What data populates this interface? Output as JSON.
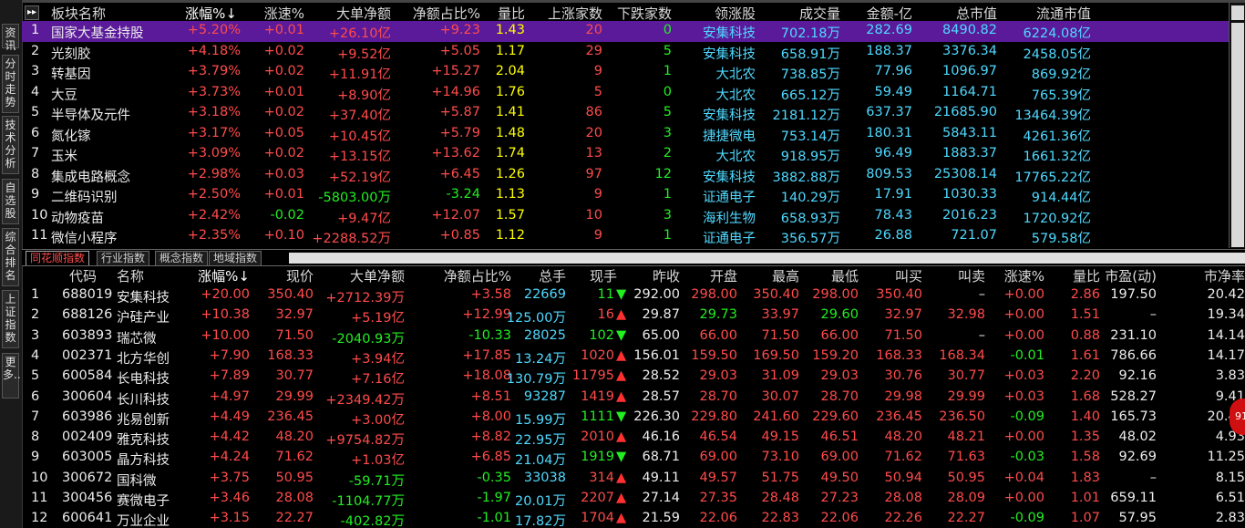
{
  "left_tabs": [
    "资讯",
    "分时走势",
    "技术分析",
    "自选股",
    "综合排名",
    "上证指数",
    "更多.."
  ],
  "upper": {
    "headers": [
      "板块名称",
      "涨幅%↓",
      "涨速%",
      "大单净额",
      "净额占比%",
      "量比",
      "上涨家数",
      "下跌家数",
      "领涨股",
      "成交量",
      "金额-亿",
      "总市值",
      "流通市值"
    ],
    "rows": [
      [
        "1",
        "国家大基金持股",
        "+5.20%",
        "+0.01",
        "+26.10亿",
        "+9.23",
        "1.43",
        "20",
        "0",
        "安集科技",
        "702.18万",
        "282.69",
        "8490.82",
        "6224.08亿"
      ],
      [
        "2",
        "光刻胶",
        "+4.18%",
        "+0.02",
        "+9.52亿",
        "+5.05",
        "1.17",
        "29",
        "5",
        "安集科技",
        "658.91万",
        "188.37",
        "3376.34",
        "2458.05亿"
      ],
      [
        "3",
        "转基因",
        "+3.79%",
        "+0.02",
        "+11.91亿",
        "+15.27",
        "2.04",
        "9",
        "1",
        "大北农",
        "738.85万",
        "77.96",
        "1096.97",
        "869.92亿"
      ],
      [
        "4",
        "大豆",
        "+3.73%",
        "+0.01",
        "+8.90亿",
        "+14.96",
        "1.76",
        "5",
        "0",
        "大北农",
        "665.12万",
        "59.49",
        "1164.71",
        "765.39亿"
      ],
      [
        "5",
        "半导体及元件",
        "+3.18%",
        "+0.02",
        "+37.40亿",
        "+5.87",
        "1.41",
        "86",
        "5",
        "安集科技",
        "2181.12万",
        "637.37",
        "21685.90",
        "13464.39亿"
      ],
      [
        "6",
        "氮化镓",
        "+3.17%",
        "+0.05",
        "+10.45亿",
        "+5.79",
        "1.48",
        "20",
        "3",
        "捷捷微电",
        "753.14万",
        "180.31",
        "5843.11",
        "4261.36亿"
      ],
      [
        "7",
        "玉米",
        "+3.09%",
        "+0.02",
        "+13.15亿",
        "+13.62",
        "1.74",
        "13",
        "2",
        "大北农",
        "918.95万",
        "96.49",
        "1883.37",
        "1661.32亿"
      ],
      [
        "8",
        "集成电路概念",
        "+2.98%",
        "+0.03",
        "+52.19亿",
        "+6.45",
        "1.26",
        "97",
        "12",
        "安集科技",
        "3882.88万",
        "809.53",
        "25308.14",
        "17765.22亿"
      ],
      [
        "9",
        "二维码识别",
        "+2.50%",
        "+0.01",
        "-5803.00万",
        "-3.24",
        "1.13",
        "9",
        "1",
        "证通电子",
        "140.29万",
        "17.91",
        "1030.33",
        "914.44亿"
      ],
      [
        "10",
        "动物疫苗",
        "+2.42%",
        "-0.02",
        "+9.47亿",
        "+12.07",
        "1.57",
        "10",
        "3",
        "海利生物",
        "658.93万",
        "78.43",
        "2016.23",
        "1720.92亿"
      ],
      [
        "11",
        "微信小程序",
        "+2.35%",
        "+0.10",
        "+2288.52万",
        "+0.85",
        "1.12",
        "9",
        "1",
        "证通电子",
        "356.57万",
        "26.88",
        "721.07",
        "579.58亿"
      ]
    ]
  },
  "tabs": [
    "同花顺指数",
    "行业指数",
    "概念指数",
    "地域指数"
  ],
  "lower": {
    "headers": [
      "代码",
      "名称",
      "涨幅%↓",
      "现价",
      "大单净额",
      "净额占比%",
      "总手",
      "现手",
      "昨收",
      "开盘",
      "最高",
      "最低",
      "叫买",
      "叫卖",
      "涨速%",
      "量比",
      "市盈(动)",
      "市净率"
    ],
    "rows": [
      [
        "1",
        "688019",
        "安集科技",
        "+20.00",
        "350.40",
        "+2712.39万",
        "+3.58",
        "22669",
        "11",
        "dn",
        "292.00",
        "298.00",
        "350.40",
        "298.00",
        "350.40",
        "–",
        "+0.00",
        "2.86",
        "197.50",
        "20.42"
      ],
      [
        "2",
        "688126",
        "沪硅产业",
        "+10.38",
        "32.97",
        "+5.19亿",
        "+12.99",
        "125.00万",
        "16",
        "up",
        "29.87",
        "29.73",
        "33.97",
        "29.60",
        "32.97",
        "32.98",
        "+0.00",
        "1.51",
        "–",
        "19.34"
      ],
      [
        "3",
        "603893",
        "瑞芯微",
        "+10.00",
        "71.50",
        "-2040.93万",
        "-10.33",
        "28025",
        "102",
        "dn",
        "65.00",
        "66.00",
        "71.50",
        "66.00",
        "71.50",
        "–",
        "+0.00",
        "0.88",
        "231.10",
        "14.14"
      ],
      [
        "4",
        "002371",
        "北方华创",
        "+7.90",
        "168.33",
        "+3.94亿",
        "+17.85",
        "13.24万",
        "1020",
        "up",
        "156.01",
        "159.50",
        "169.50",
        "159.20",
        "168.33",
        "168.34",
        "-0.01",
        "1.61",
        "786.66",
        "14.17"
      ],
      [
        "5",
        "600584",
        "长电科技",
        "+7.89",
        "30.77",
        "+7.16亿",
        "+18.08",
        "130.79万",
        "11795",
        "up",
        "28.52",
        "29.03",
        "31.09",
        "29.03",
        "30.76",
        "30.77",
        "+0.03",
        "2.20",
        "92.16",
        "3.83"
      ],
      [
        "6",
        "300604",
        "长川科技",
        "+4.97",
        "29.99",
        "+2349.42万",
        "+8.51",
        "93287",
        "1419",
        "up",
        "28.57",
        "28.70",
        "30.07",
        "28.70",
        "29.98",
        "29.99",
        "+0.03",
        "1.68",
        "528.27",
        "9.41"
      ],
      [
        "7",
        "603986",
        "兆易创新",
        "+4.49",
        "236.45",
        "+3.00亿",
        "+8.00",
        "15.99万",
        "1111",
        "dn",
        "226.30",
        "229.80",
        "241.60",
        "229.60",
        "236.45",
        "236.50",
        "-0.09",
        "1.40",
        "165.73",
        "20.46"
      ],
      [
        "8",
        "002409",
        "雅克科技",
        "+4.42",
        "48.20",
        "+9754.82万",
        "+8.82",
        "22.95万",
        "2010",
        "up",
        "46.16",
        "46.54",
        "49.15",
        "46.51",
        "48.20",
        "48.21",
        "+0.00",
        "1.35",
        "48.02",
        "4.93"
      ],
      [
        "9",
        "603005",
        "晶方科技",
        "+4.24",
        "71.62",
        "+1.03亿",
        "+6.85",
        "21.04万",
        "1919",
        "dn",
        "68.71",
        "69.00",
        "73.10",
        "69.00",
        "71.62",
        "71.63",
        "-0.03",
        "1.58",
        "92.69",
        "11.25"
      ],
      [
        "10",
        "300672",
        "国科微",
        "+3.75",
        "50.95",
        "-59.71万",
        "-0.35",
        "33038",
        "314",
        "up",
        "49.11",
        "49.57",
        "51.75",
        "49.50",
        "50.94",
        "50.95",
        "+0.04",
        "1.83",
        "–",
        "8.15"
      ],
      [
        "11",
        "300456",
        "赛微电子",
        "+3.46",
        "28.08",
        "-1104.77万",
        "-1.97",
        "20.01万",
        "2207",
        "up",
        "27.14",
        "27.35",
        "28.48",
        "27.23",
        "28.08",
        "28.09",
        "+0.00",
        "1.01",
        "659.11",
        "6.51"
      ],
      [
        "12",
        "600641",
        "万业企业",
        "+3.15",
        "22.27",
        "-402.82万",
        "-1.01",
        "17.82万",
        "1704",
        "up",
        "21.59",
        "22.06",
        "22.83",
        "22.06",
        "22.26",
        "22.27",
        "-0.09",
        "1.07",
        "57.95",
        "2.83"
      ]
    ]
  },
  "badge": "91",
  "colors": {
    "up": "#ff4b4b",
    "down": "#22ee22",
    "cyan": "#4fd9ff",
    "yellow": "#ffff00",
    "selected": "#5a1a99"
  }
}
